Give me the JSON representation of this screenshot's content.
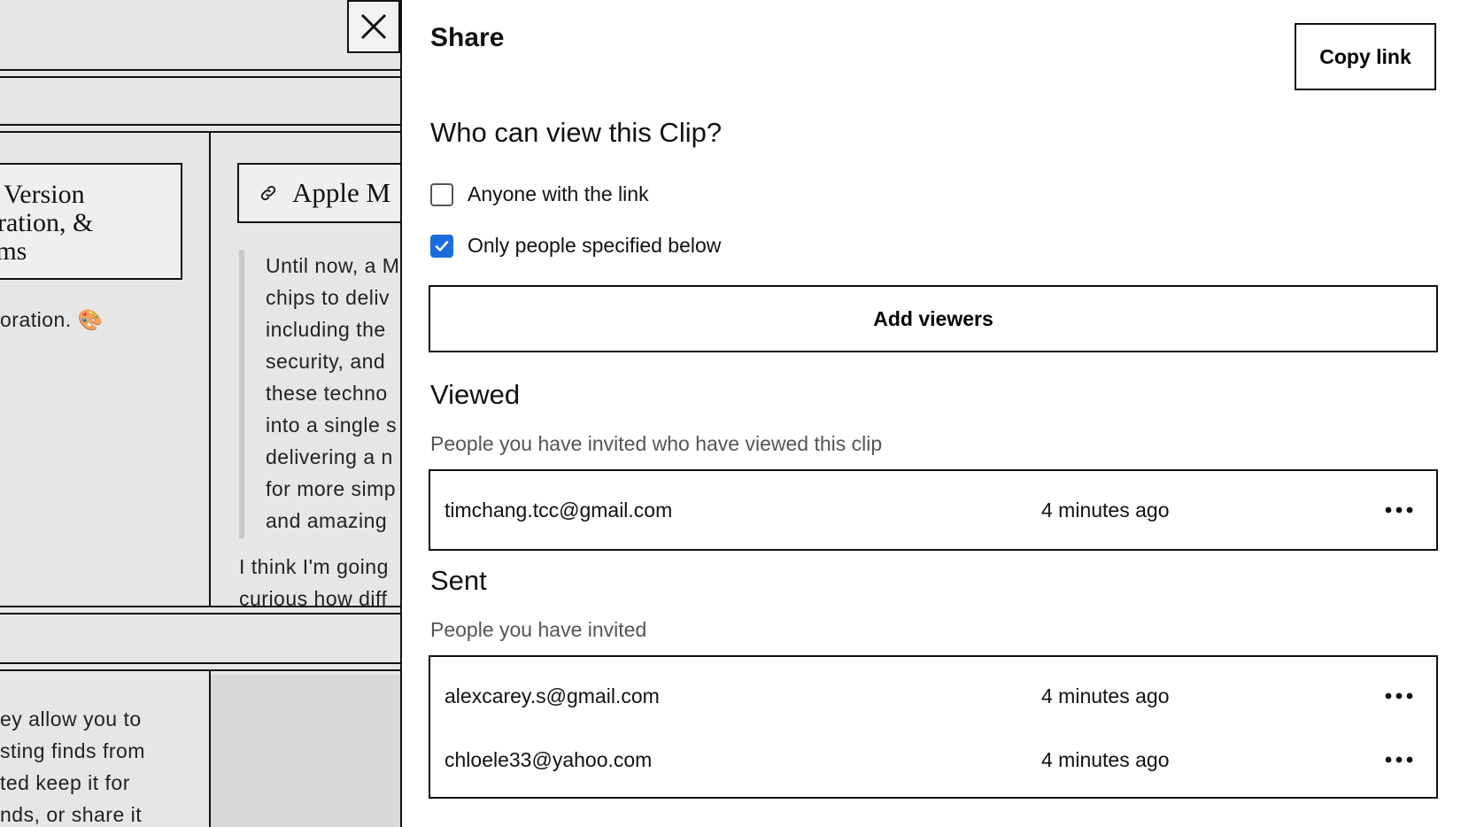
{
  "background": {
    "card_left_title": "n Version\noration, &\nams",
    "card_left_caption": "oration. 🎨",
    "card_right_title": "Apple M",
    "quote_lines": "Until now, a M\nchips to deliv\nincluding the\nsecurity, and\nthese techno\ninto a single s\ndelivering a n\nfor more simp\nand amazing",
    "para_lines": "I think I'm going\ncurious how diff",
    "bottom_lines": "ey allow you to\nsting finds from\nted keep it for\nnds, or share it"
  },
  "share": {
    "title": "Share",
    "copy_link": "Copy link",
    "question": "Who can view this Clip?",
    "options": [
      {
        "label": "Anyone with the link",
        "checked": false
      },
      {
        "label": "Only people specified below",
        "checked": true
      }
    ],
    "add_viewers": "Add viewers",
    "viewed": {
      "heading": "Viewed",
      "subtitle": "People you have invited who have viewed this clip",
      "people": [
        {
          "email": "timchang.tcc@gmail.com",
          "time": "4 minutes ago"
        }
      ]
    },
    "sent": {
      "heading": "Sent",
      "subtitle": "People you have invited",
      "people": [
        {
          "email": "alexcarey.s@gmail.com",
          "time": "4 minutes ago"
        },
        {
          "email": "chloele33@yahoo.com",
          "time": "4 minutes ago"
        }
      ]
    }
  },
  "icons": {
    "close": "close-icon",
    "link": "link-icon",
    "more": "more-horizontal-icon",
    "check": "check-icon"
  },
  "colors": {
    "checkbox_accent": "#1a6de0",
    "background_page": "#e6e6e6"
  }
}
